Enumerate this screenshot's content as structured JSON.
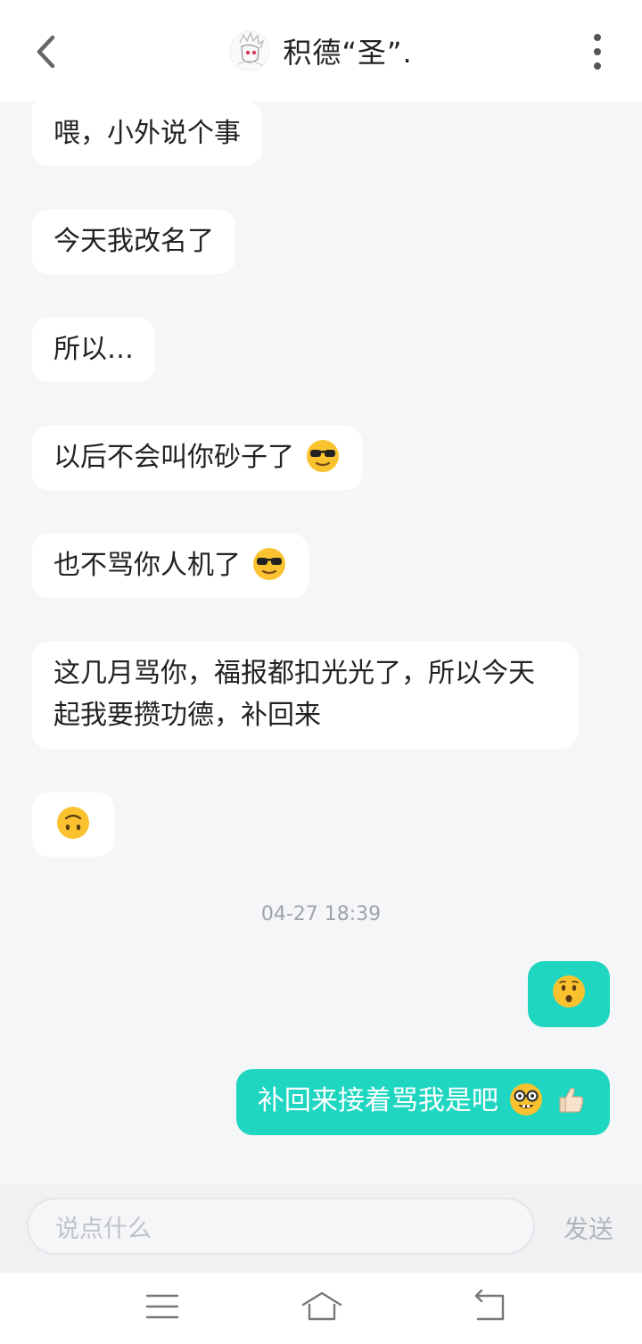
{
  "header": {
    "title": "积德“圣”.",
    "back_icon": "chevron-left-icon",
    "more_icon": "more-vertical-icon"
  },
  "messages_incoming": [
    {
      "text": "喂，小外说个事",
      "emoji": ""
    },
    {
      "text": "今天我改名了",
      "emoji": ""
    },
    {
      "text": "所以…",
      "emoji": ""
    },
    {
      "text": "以后不会叫你砂子了",
      "emoji": "sunglasses-face"
    },
    {
      "text": "也不骂你人机了",
      "emoji": "sunglasses-face"
    },
    {
      "text": "这几月骂你，福报都扣光光了，所以今天起我要攒功德，补回来",
      "emoji": ""
    },
    {
      "text": "",
      "emoji": "upside-down-face"
    }
  ],
  "timestamp": "04-27 18:39",
  "messages_outgoing": [
    {
      "text": "",
      "emoji": "hushed-face"
    },
    {
      "text": "补回来接着骂我是吧",
      "emoji": "nerd-face thumbs-up"
    }
  ],
  "input": {
    "placeholder": "说点什么",
    "send_label": "发送"
  },
  "nav": {
    "menu_icon": "menu-icon",
    "home_icon": "home-icon",
    "back_icon": "back-icon"
  },
  "colors": {
    "accent": "#1fd6c0",
    "background": "#f5f6f8",
    "bubble_in": "#ffffff"
  }
}
